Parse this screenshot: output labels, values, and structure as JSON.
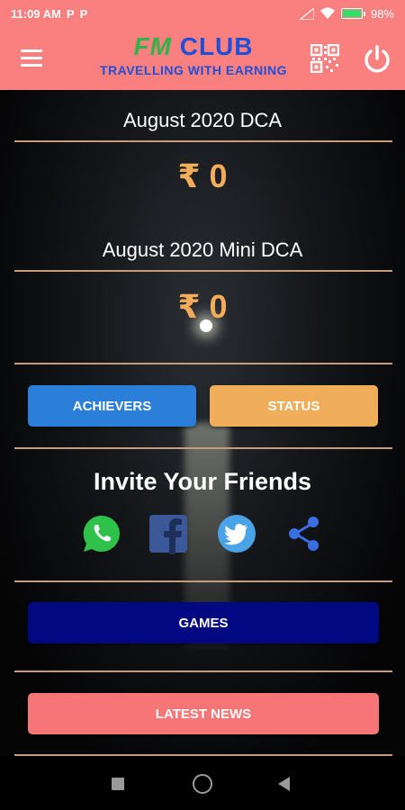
{
  "status_bar": {
    "time": "11:09 AM",
    "app_icons": [
      "P",
      "P"
    ],
    "battery": "98%",
    "battery_level": 0.98,
    "icons": [
      "signal-icon",
      "wifi-icon",
      "battery-charging-icon"
    ]
  },
  "app_bar": {
    "logo_fm": "FM",
    "logo_club": "CLUB",
    "tagline": "TRAVELLING WITH EARNING",
    "icons": [
      "menu-icon",
      "qr-code-icon",
      "power-icon"
    ],
    "colors": {
      "background": "#fa7f7f",
      "logo_fm": "#2fb34a",
      "logo_blue": "#1f4fd8"
    }
  },
  "dca": {
    "title": "August 2020 DCA",
    "amount": "₹ 0"
  },
  "mini_dca": {
    "title": "August 2020 Mini DCA",
    "amount": "₹ 0"
  },
  "buttons": {
    "achievers": "ACHIEVERS",
    "status": "STATUS",
    "games": "GAMES",
    "latest_news": "LATEST NEWS"
  },
  "invite": {
    "title": "Invite Your Friends",
    "share_options": [
      "whatsapp-icon",
      "facebook-icon",
      "twitter-icon",
      "share-icon"
    ]
  },
  "colors": {
    "amount": "#f3ad5a",
    "achievers": "#2c7fd9",
    "status": "#f0ad5a",
    "games": "#020782",
    "latest_news": "#f67677",
    "divider": "#c99b78"
  },
  "nav_bar": {
    "icons": [
      "recent-apps-icon",
      "home-icon",
      "back-icon"
    ]
  }
}
